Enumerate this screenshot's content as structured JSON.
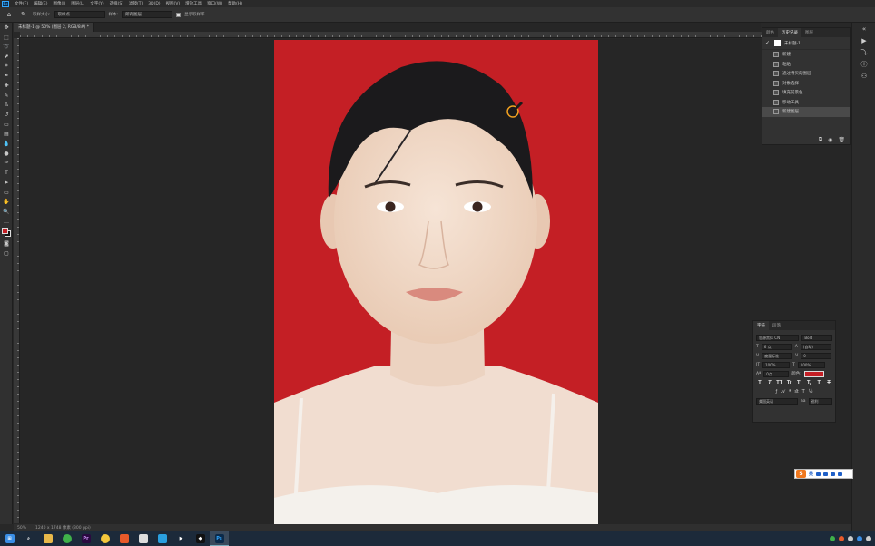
{
  "menubar": {
    "logo": "Ps",
    "items": [
      "文件(F)",
      "编辑(E)",
      "图像(I)",
      "图层(L)",
      "文字(Y)",
      "选择(S)",
      "滤镜(T)",
      "3D(D)",
      "视图(V)",
      "增效工具",
      "窗口(W)",
      "帮助(H)"
    ]
  },
  "options": {
    "sample_size_label": "取样大小:",
    "sample_size_value": "取样点",
    "sample_label": "样本:",
    "sample_value": "所有图层",
    "show_ring_label": "显示取样环"
  },
  "doc_tab": {
    "title": "未标题-1 @ 50% (图层 2, RGB/8#) *"
  },
  "history_panel": {
    "tabs": [
      "颜色",
      "历史记录",
      "图层"
    ],
    "active_tab": 1,
    "snapshot_label": "未标题-1",
    "items": [
      "新建",
      "粘贴",
      "通过拷贝的图层",
      "对象选择",
      "填充前景色",
      "移动工具",
      "新建图层"
    ],
    "selected_index": 6
  },
  "char_panel": {
    "tabs": [
      "字符",
      "段落"
    ],
    "font_family": "思源黑体 CN",
    "font_style": "Bold",
    "font_size": "6 点",
    "leading": "(自动)",
    "tracking": "0",
    "kerning": "度量标准",
    "vscale": "100%",
    "hscale": "100%",
    "baseline": "0点",
    "color_label": "颜色:",
    "language": "美国英语",
    "aa_label": "aa",
    "aa_mode": "锐利",
    "style_buttons": [
      "T",
      "T",
      "TT",
      "Tr",
      "T'",
      "T,",
      "T",
      "T"
    ]
  },
  "status": {
    "zoom": "50%",
    "doc_size": "1240 x 1748 像素 (300 ppi)"
  },
  "ime": {
    "logo": "S",
    "text": "英"
  },
  "colors": {
    "background_red": "#c41f25",
    "fg": "#c41f25",
    "bg": "#111111"
  }
}
